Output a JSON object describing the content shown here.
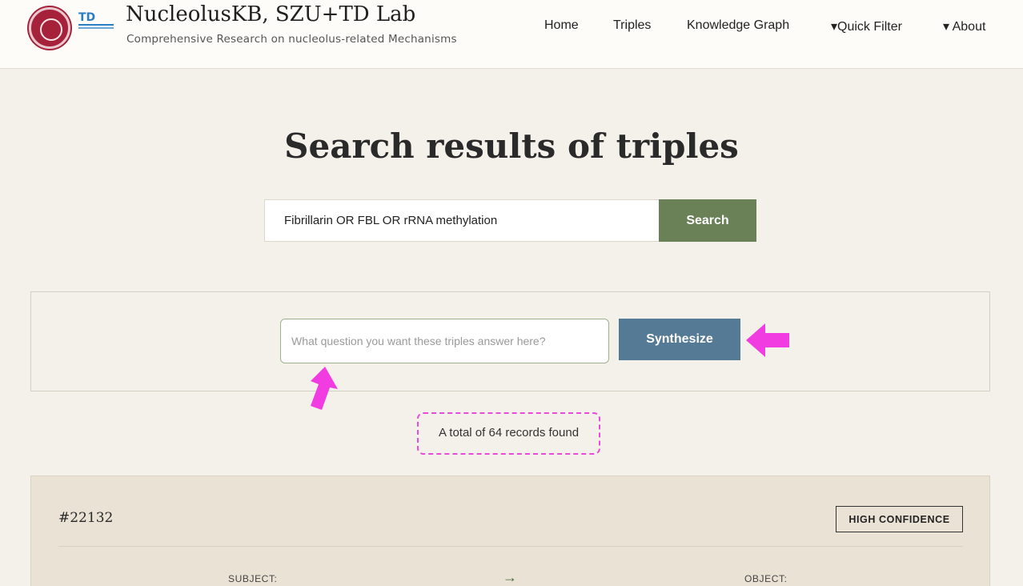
{
  "header": {
    "title": "NucleolusKB, SZU+TD Lab",
    "subtitle": "Comprehensive Research on nucleolus-related Mechanisms",
    "logo_td_text": "TD",
    "nav": {
      "home": "Home",
      "triples": "Triples",
      "knowledge_graph": "Knowledge Graph",
      "quick_filter": "▾Quick Filter",
      "about": "▾ About"
    }
  },
  "page": {
    "title": "Search results of triples"
  },
  "search": {
    "value": "Fibrillarin OR FBL OR rRNA methylation",
    "button_label": "Search"
  },
  "synthesize": {
    "placeholder": "What question you want these triples answer here?",
    "button_label": "Synthesize"
  },
  "results": {
    "count_text": "A total of 64 records found"
  },
  "record": {
    "id": "#22132",
    "confidence": "HIGH CONFIDENCE",
    "subject_label": "SUBJECT:",
    "arrow": "→",
    "object_label": "OBJECT:"
  },
  "colors": {
    "background": "#f4f1ea",
    "search_button": "#6a8157",
    "synthesize_button": "#557a96",
    "annotation": "#f03ce0",
    "seal": "#a6213a"
  }
}
